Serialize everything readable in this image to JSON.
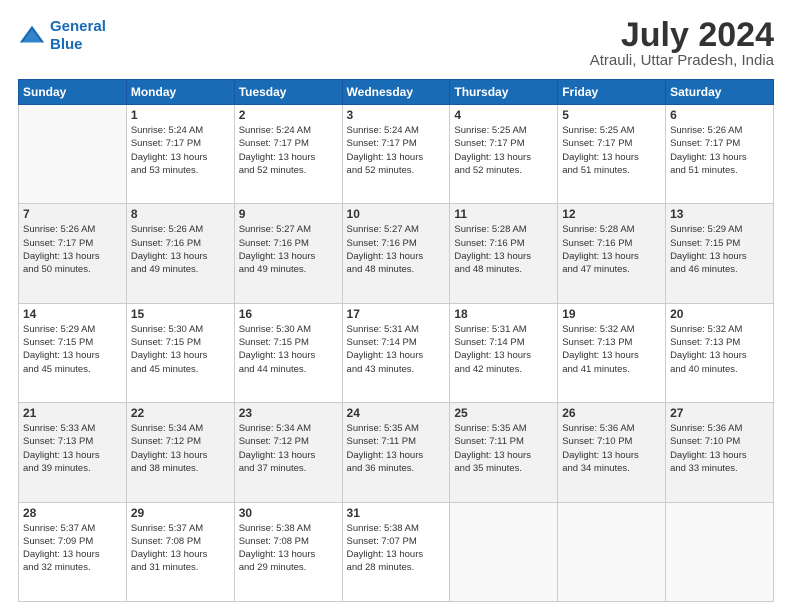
{
  "logo": {
    "line1": "General",
    "line2": "Blue"
  },
  "title": "July 2024",
  "subtitle": "Atrauli, Uttar Pradesh, India",
  "headers": [
    "Sunday",
    "Monday",
    "Tuesday",
    "Wednesday",
    "Thursday",
    "Friday",
    "Saturday"
  ],
  "weeks": [
    [
      {
        "day": "",
        "sunrise": "",
        "sunset": "",
        "daylight": ""
      },
      {
        "day": "1",
        "sunrise": "Sunrise: 5:24 AM",
        "sunset": "Sunset: 7:17 PM",
        "daylight": "Daylight: 13 hours and 53 minutes."
      },
      {
        "day": "2",
        "sunrise": "Sunrise: 5:24 AM",
        "sunset": "Sunset: 7:17 PM",
        "daylight": "Daylight: 13 hours and 52 minutes."
      },
      {
        "day": "3",
        "sunrise": "Sunrise: 5:24 AM",
        "sunset": "Sunset: 7:17 PM",
        "daylight": "Daylight: 13 hours and 52 minutes."
      },
      {
        "day": "4",
        "sunrise": "Sunrise: 5:25 AM",
        "sunset": "Sunset: 7:17 PM",
        "daylight": "Daylight: 13 hours and 52 minutes."
      },
      {
        "day": "5",
        "sunrise": "Sunrise: 5:25 AM",
        "sunset": "Sunset: 7:17 PM",
        "daylight": "Daylight: 13 hours and 51 minutes."
      },
      {
        "day": "6",
        "sunrise": "Sunrise: 5:26 AM",
        "sunset": "Sunset: 7:17 PM",
        "daylight": "Daylight: 13 hours and 51 minutes."
      }
    ],
    [
      {
        "day": "7",
        "sunrise": "Sunrise: 5:26 AM",
        "sunset": "Sunset: 7:17 PM",
        "daylight": "Daylight: 13 hours and 50 minutes."
      },
      {
        "day": "8",
        "sunrise": "Sunrise: 5:26 AM",
        "sunset": "Sunset: 7:16 PM",
        "daylight": "Daylight: 13 hours and 49 minutes."
      },
      {
        "day": "9",
        "sunrise": "Sunrise: 5:27 AM",
        "sunset": "Sunset: 7:16 PM",
        "daylight": "Daylight: 13 hours and 49 minutes."
      },
      {
        "day": "10",
        "sunrise": "Sunrise: 5:27 AM",
        "sunset": "Sunset: 7:16 PM",
        "daylight": "Daylight: 13 hours and 48 minutes."
      },
      {
        "day": "11",
        "sunrise": "Sunrise: 5:28 AM",
        "sunset": "Sunset: 7:16 PM",
        "daylight": "Daylight: 13 hours and 48 minutes."
      },
      {
        "day": "12",
        "sunrise": "Sunrise: 5:28 AM",
        "sunset": "Sunset: 7:16 PM",
        "daylight": "Daylight: 13 hours and 47 minutes."
      },
      {
        "day": "13",
        "sunrise": "Sunrise: 5:29 AM",
        "sunset": "Sunset: 7:15 PM",
        "daylight": "Daylight: 13 hours and 46 minutes."
      }
    ],
    [
      {
        "day": "14",
        "sunrise": "Sunrise: 5:29 AM",
        "sunset": "Sunset: 7:15 PM",
        "daylight": "Daylight: 13 hours and 45 minutes."
      },
      {
        "day": "15",
        "sunrise": "Sunrise: 5:30 AM",
        "sunset": "Sunset: 7:15 PM",
        "daylight": "Daylight: 13 hours and 45 minutes."
      },
      {
        "day": "16",
        "sunrise": "Sunrise: 5:30 AM",
        "sunset": "Sunset: 7:15 PM",
        "daylight": "Daylight: 13 hours and 44 minutes."
      },
      {
        "day": "17",
        "sunrise": "Sunrise: 5:31 AM",
        "sunset": "Sunset: 7:14 PM",
        "daylight": "Daylight: 13 hours and 43 minutes."
      },
      {
        "day": "18",
        "sunrise": "Sunrise: 5:31 AM",
        "sunset": "Sunset: 7:14 PM",
        "daylight": "Daylight: 13 hours and 42 minutes."
      },
      {
        "day": "19",
        "sunrise": "Sunrise: 5:32 AM",
        "sunset": "Sunset: 7:13 PM",
        "daylight": "Daylight: 13 hours and 41 minutes."
      },
      {
        "day": "20",
        "sunrise": "Sunrise: 5:32 AM",
        "sunset": "Sunset: 7:13 PM",
        "daylight": "Daylight: 13 hours and 40 minutes."
      }
    ],
    [
      {
        "day": "21",
        "sunrise": "Sunrise: 5:33 AM",
        "sunset": "Sunset: 7:13 PM",
        "daylight": "Daylight: 13 hours and 39 minutes."
      },
      {
        "day": "22",
        "sunrise": "Sunrise: 5:34 AM",
        "sunset": "Sunset: 7:12 PM",
        "daylight": "Daylight: 13 hours and 38 minutes."
      },
      {
        "day": "23",
        "sunrise": "Sunrise: 5:34 AM",
        "sunset": "Sunset: 7:12 PM",
        "daylight": "Daylight: 13 hours and 37 minutes."
      },
      {
        "day": "24",
        "sunrise": "Sunrise: 5:35 AM",
        "sunset": "Sunset: 7:11 PM",
        "daylight": "Daylight: 13 hours and 36 minutes."
      },
      {
        "day": "25",
        "sunrise": "Sunrise: 5:35 AM",
        "sunset": "Sunset: 7:11 PM",
        "daylight": "Daylight: 13 hours and 35 minutes."
      },
      {
        "day": "26",
        "sunrise": "Sunrise: 5:36 AM",
        "sunset": "Sunset: 7:10 PM",
        "daylight": "Daylight: 13 hours and 34 minutes."
      },
      {
        "day": "27",
        "sunrise": "Sunrise: 5:36 AM",
        "sunset": "Sunset: 7:10 PM",
        "daylight": "Daylight: 13 hours and 33 minutes."
      }
    ],
    [
      {
        "day": "28",
        "sunrise": "Sunrise: 5:37 AM",
        "sunset": "Sunset: 7:09 PM",
        "daylight": "Daylight: 13 hours and 32 minutes."
      },
      {
        "day": "29",
        "sunrise": "Sunrise: 5:37 AM",
        "sunset": "Sunset: 7:08 PM",
        "daylight": "Daylight: 13 hours and 31 minutes."
      },
      {
        "day": "30",
        "sunrise": "Sunrise: 5:38 AM",
        "sunset": "Sunset: 7:08 PM",
        "daylight": "Daylight: 13 hours and 29 minutes."
      },
      {
        "day": "31",
        "sunrise": "Sunrise: 5:38 AM",
        "sunset": "Sunset: 7:07 PM",
        "daylight": "Daylight: 13 hours and 28 minutes."
      },
      {
        "day": "",
        "sunrise": "",
        "sunset": "",
        "daylight": ""
      },
      {
        "day": "",
        "sunrise": "",
        "sunset": "",
        "daylight": ""
      },
      {
        "day": "",
        "sunrise": "",
        "sunset": "",
        "daylight": ""
      }
    ]
  ]
}
